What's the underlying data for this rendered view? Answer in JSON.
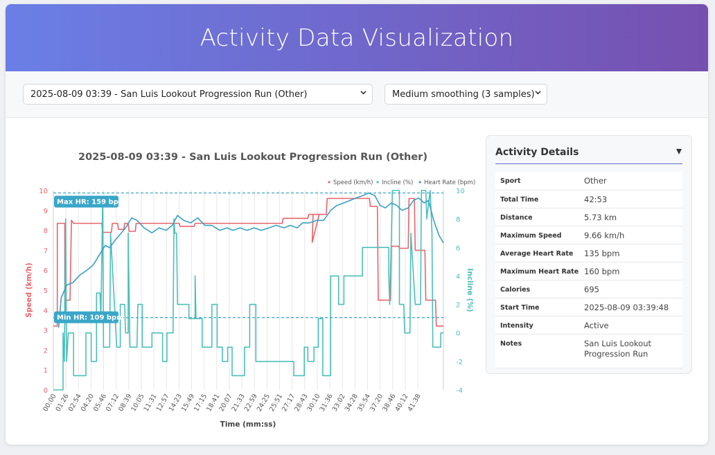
{
  "app": {
    "title": "Activity Data Visualization"
  },
  "controls": {
    "activity_select": "2025-08-09 03:39 - San Luis Lookout Progression Run (Other)",
    "smoothing_select": "Medium smoothing (3 samples)"
  },
  "details": {
    "title": "Activity Details",
    "rows": [
      {
        "key": "Sport",
        "value": "Other"
      },
      {
        "key": "Total Time",
        "value": "42:53"
      },
      {
        "key": "Distance",
        "value": "5.73 km"
      },
      {
        "key": "Maximum Speed",
        "value": "9.66 km/h"
      },
      {
        "key": "Average Heart Rate",
        "value": "135 bpm"
      },
      {
        "key": "Maximum Heart Rate",
        "value": "160 bpm"
      },
      {
        "key": "Calories",
        "value": "695"
      },
      {
        "key": "Start Time",
        "value": "2025-08-09 03:39:48"
      },
      {
        "key": "Intensity",
        "value": "Active"
      },
      {
        "key": "Notes",
        "value": "San Luis Lookout Progression Run"
      }
    ]
  },
  "chart_data": {
    "type": "line",
    "title": "2025-08-09 03:39 - San Luis Lookout Progression Run (Other)",
    "xlabel": "Time (mm:ss)",
    "ylabel_left": "Speed (km/h)",
    "ylabel_right": "Incline (%)",
    "x_ticks": [
      "00:00",
      "01:26",
      "02:54",
      "04:20",
      "05:46",
      "07:12",
      "08:39",
      "10:05",
      "11:31",
      "12:57",
      "14:23",
      "15:49",
      "17:15",
      "18:41",
      "20:07",
      "21:33",
      "22:59",
      "24:25",
      "25:51",
      "27:17",
      "28:43",
      "30:10",
      "31:36",
      "33:02",
      "34:28",
      "35:54",
      "37:20",
      "38:46",
      "40:12",
      "41:38"
    ],
    "x_range_min": [
      0,
      42.9
    ],
    "y_left_range": [
      0,
      10
    ],
    "y_left_ticks": [
      "0",
      "1",
      "2",
      "3",
      "4",
      "5",
      "6",
      "7",
      "8",
      "9",
      "10"
    ],
    "y_right_range": [
      -4,
      10
    ],
    "y_right_ticks": [
      "-4",
      "-2",
      "0",
      "2",
      "4",
      "6",
      "8",
      "10"
    ],
    "hr_range_bpm": [
      80,
      160
    ],
    "legend": [
      "Speed (km/h)",
      "Incline (%)",
      "Heart Rate (bpm)"
    ],
    "legend_position": "top-right",
    "colors": {
      "speed": "#e8636b",
      "incline": "#4bbfb9",
      "heart_rate": "#3a9fc4",
      "annotation": "#3aa6c8"
    },
    "annotations": [
      {
        "label": "Max HR: 159 bpm",
        "bpm": 159
      },
      {
        "label": "Min HR: 109 bpm",
        "bpm": 109
      }
    ],
    "series": [
      {
        "name": "Speed (km/h)",
        "axis": "left",
        "points": [
          [
            0,
            3.2
          ],
          [
            0.45,
            3.2
          ],
          [
            0.45,
            8.35
          ],
          [
            1.3,
            8.35
          ],
          [
            1.3,
            3.7
          ],
          [
            1.45,
            4.5
          ],
          [
            1.9,
            4.5
          ],
          [
            2.05,
            8.5
          ],
          [
            2.3,
            8.35
          ],
          [
            5.5,
            8.35
          ],
          [
            5.6,
            7.9
          ],
          [
            6.6,
            7.9
          ],
          [
            6.7,
            8.35
          ],
          [
            7.3,
            8.35
          ],
          [
            7.4,
            8.05
          ],
          [
            8.0,
            8.05
          ],
          [
            8.1,
            8.35
          ],
          [
            8.5,
            8.35
          ],
          [
            8.6,
            7.95
          ],
          [
            9.3,
            7.95
          ],
          [
            9.4,
            8.35
          ],
          [
            14.3,
            8.35
          ],
          [
            14.4,
            8.2
          ],
          [
            16.0,
            8.2
          ],
          [
            16.1,
            8.35
          ],
          [
            26.0,
            8.35
          ],
          [
            26.1,
            8.6
          ],
          [
            28.9,
            8.6
          ],
          [
            29.0,
            8.8
          ],
          [
            30.2,
            8.8
          ],
          [
            29.4,
            7.4
          ],
          [
            29.5,
            8.8
          ],
          [
            31.0,
            8.8
          ],
          [
            31.1,
            9.6
          ],
          [
            35.9,
            9.6
          ],
          [
            36.0,
            9.2
          ],
          [
            36.8,
            9.2
          ],
          [
            36.9,
            4.5
          ],
          [
            38.3,
            4.5
          ],
          [
            38.4,
            7.2
          ],
          [
            39.2,
            7.2
          ],
          [
            39.3,
            7.1
          ],
          [
            40.3,
            7.1
          ],
          [
            40.4,
            9.6
          ],
          [
            41.0,
            9.6
          ],
          [
            41.1,
            7.0
          ],
          [
            42.2,
            7.0
          ],
          [
            42.3,
            4.5
          ],
          [
            43.4,
            4.5
          ],
          [
            43.5,
            3.2
          ],
          [
            44.3,
            3.2
          ]
        ]
      },
      {
        "name": "Incline (%)",
        "axis": "right",
        "points": [
          [
            0,
            -4
          ],
          [
            1.1,
            -4
          ],
          [
            1.1,
            0
          ],
          [
            1.25,
            -2
          ],
          [
            1.4,
            8
          ],
          [
            1.5,
            -2
          ],
          [
            1.7,
            0
          ],
          [
            2.3,
            0
          ],
          [
            2.3,
            -3
          ],
          [
            3.7,
            -3
          ],
          [
            3.7,
            0
          ],
          [
            4.3,
            0
          ],
          [
            4.3,
            -2
          ],
          [
            4.9,
            -2
          ],
          [
            4.9,
            2.8
          ],
          [
            5.3,
            2.8
          ],
          [
            5.4,
            1
          ],
          [
            5.6,
            9.5
          ],
          [
            5.7,
            -1
          ],
          [
            6.4,
            -1
          ],
          [
            6.5,
            7
          ],
          [
            7.2,
            -1
          ],
          [
            7.6,
            -1
          ],
          [
            7.6,
            2
          ],
          [
            8.1,
            2
          ],
          [
            8.2,
            0
          ],
          [
            8.5,
            0
          ],
          [
            8.5,
            7
          ],
          [
            8.7,
            -1
          ],
          [
            9.5,
            -1
          ],
          [
            9.6,
            2
          ],
          [
            10.1,
            2
          ],
          [
            10.1,
            -1
          ],
          [
            11.2,
            -1
          ],
          [
            11.2,
            0
          ],
          [
            12.4,
            0
          ],
          [
            12.4,
            -2
          ],
          [
            12.9,
            -2
          ],
          [
            12.9,
            0
          ],
          [
            13.6,
            0
          ],
          [
            13.7,
            8
          ],
          [
            13.8,
            7
          ],
          [
            14.0,
            7
          ],
          [
            14.1,
            2
          ],
          [
            15.4,
            2
          ],
          [
            15.4,
            1
          ],
          [
            16.1,
            1
          ],
          [
            16.1,
            4
          ],
          [
            16.2,
            1
          ],
          [
            16.9,
            1
          ],
          [
            16.9,
            -1
          ],
          [
            18.0,
            -1
          ],
          [
            18.0,
            2
          ],
          [
            18.6,
            2
          ],
          [
            18.6,
            -1
          ],
          [
            19.2,
            -1
          ],
          [
            19.2,
            -2
          ],
          [
            19.8,
            -2
          ],
          [
            19.8,
            -1
          ],
          [
            20.3,
            -1
          ],
          [
            20.3,
            -3
          ],
          [
            21.7,
            -3
          ],
          [
            21.7,
            -1
          ],
          [
            22.3,
            -1
          ],
          [
            22.3,
            2
          ],
          [
            23.0,
            2
          ],
          [
            23.0,
            -2
          ],
          [
            27.3,
            -2
          ],
          [
            27.3,
            -3
          ],
          [
            28.5,
            -3
          ],
          [
            28.5,
            -1
          ],
          [
            28.9,
            -1
          ],
          [
            28.9,
            -2
          ],
          [
            29.6,
            -2
          ],
          [
            29.6,
            -1
          ],
          [
            30.1,
            -1
          ],
          [
            30.1,
            1
          ],
          [
            30.6,
            1
          ],
          [
            30.6,
            -3
          ],
          [
            31.5,
            -3
          ],
          [
            31.5,
            4
          ],
          [
            32.4,
            4
          ],
          [
            32.4,
            2
          ],
          [
            33.0,
            2
          ],
          [
            33.0,
            4
          ],
          [
            35.1,
            4
          ],
          [
            35.1,
            6
          ],
          [
            38.1,
            6
          ],
          [
            38.1,
            4
          ],
          [
            38.2,
            2
          ],
          [
            38.4,
            7
          ],
          [
            38.5,
            10
          ],
          [
            39.3,
            10
          ],
          [
            39.3,
            2
          ],
          [
            39.8,
            2
          ],
          [
            39.9,
            0
          ],
          [
            40.5,
            0
          ],
          [
            40.6,
            7
          ],
          [
            41.1,
            2
          ],
          [
            41.7,
            2
          ],
          [
            41.8,
            10
          ],
          [
            42.3,
            10
          ],
          [
            42.4,
            8
          ],
          [
            42.8,
            10
          ],
          [
            43.0,
            7
          ],
          [
            43.1,
            -1
          ],
          [
            44.0,
            -1
          ],
          [
            44.0,
            0
          ],
          [
            44.3,
            0
          ]
        ]
      },
      {
        "name": "Heart Rate (bpm)",
        "axis": "hr",
        "points": [
          [
            0.6,
            105
          ],
          [
            0.9,
            117
          ],
          [
            1.5,
            122
          ],
          [
            2.2,
            123
          ],
          [
            3.0,
            126
          ],
          [
            3.8,
            128
          ],
          [
            4.5,
            130
          ],
          [
            5.2,
            134
          ],
          [
            5.9,
            138
          ],
          [
            6.4,
            137
          ],
          [
            7.0,
            140
          ],
          [
            7.5,
            142
          ],
          [
            8.2,
            145
          ],
          [
            8.9,
            149
          ],
          [
            9.5,
            148
          ],
          [
            10.3,
            145
          ],
          [
            11.2,
            143
          ],
          [
            12.0,
            145
          ],
          [
            12.8,
            144
          ],
          [
            13.5,
            146
          ],
          [
            14.1,
            150
          ],
          [
            14.8,
            148
          ],
          [
            15.6,
            147
          ],
          [
            16.4,
            149
          ],
          [
            17.2,
            146
          ],
          [
            18.0,
            146
          ],
          [
            18.9,
            144
          ],
          [
            19.7,
            145
          ],
          [
            20.4,
            144
          ],
          [
            21.2,
            145
          ],
          [
            22.0,
            144
          ],
          [
            22.8,
            145
          ],
          [
            23.6,
            144
          ],
          [
            24.5,
            145
          ],
          [
            25.3,
            146
          ],
          [
            26.2,
            145
          ],
          [
            26.9,
            146
          ],
          [
            27.7,
            145
          ],
          [
            28.3,
            147
          ],
          [
            29.1,
            147
          ],
          [
            29.9,
            148
          ],
          [
            30.7,
            148
          ],
          [
            31.5,
            152
          ],
          [
            32.2,
            154
          ],
          [
            33.0,
            155
          ],
          [
            33.7,
            156
          ],
          [
            34.4,
            157
          ],
          [
            35.2,
            158
          ],
          [
            35.8,
            159
          ],
          [
            36.5,
            158
          ],
          [
            37.1,
            154
          ],
          [
            37.7,
            153
          ],
          [
            38.4,
            155
          ],
          [
            39.0,
            154
          ],
          [
            39.6,
            152
          ],
          [
            40.3,
            153
          ],
          [
            40.9,
            156
          ],
          [
            41.5,
            157
          ],
          [
            42.1,
            155
          ],
          [
            42.6,
            156
          ],
          [
            43.2,
            148
          ],
          [
            43.8,
            142
          ],
          [
            44.3,
            139
          ]
        ]
      }
    ]
  }
}
